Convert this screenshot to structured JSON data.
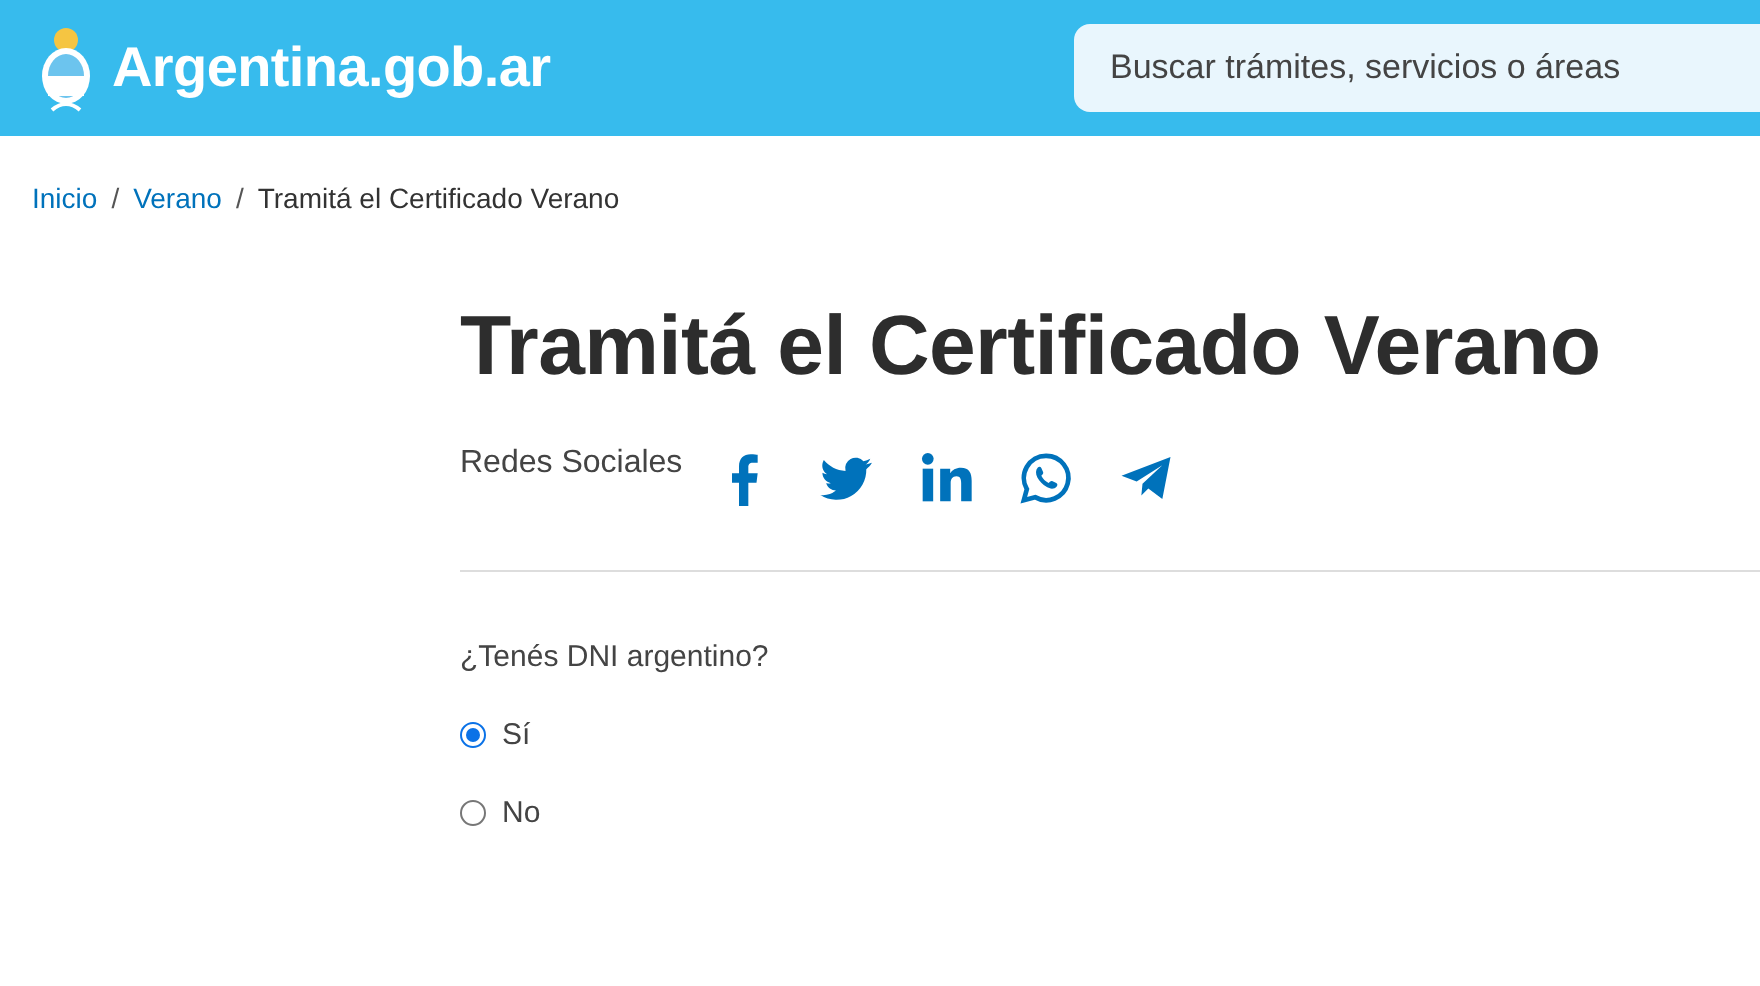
{
  "header": {
    "logo_text": "Argentina.gob.ar",
    "search": {
      "placeholder": "Buscar trámites, servicios o áreas"
    }
  },
  "breadcrumb": [
    {
      "label": "Inicio",
      "link": true
    },
    {
      "separator": "/",
      "label": "Verano",
      "link": true
    },
    {
      "separator": "/",
      "label": "Tramitá el Certificado Verano",
      "link": false
    }
  ],
  "title": "Tramitá el Certificado Verano",
  "share": {
    "label": "Redes Sociales"
  },
  "question": {
    "label": "¿Tenés DNI argentino?",
    "options": [
      {
        "label": "Sí",
        "selected": true
      },
      {
        "label": "No",
        "selected": false
      }
    ]
  }
}
